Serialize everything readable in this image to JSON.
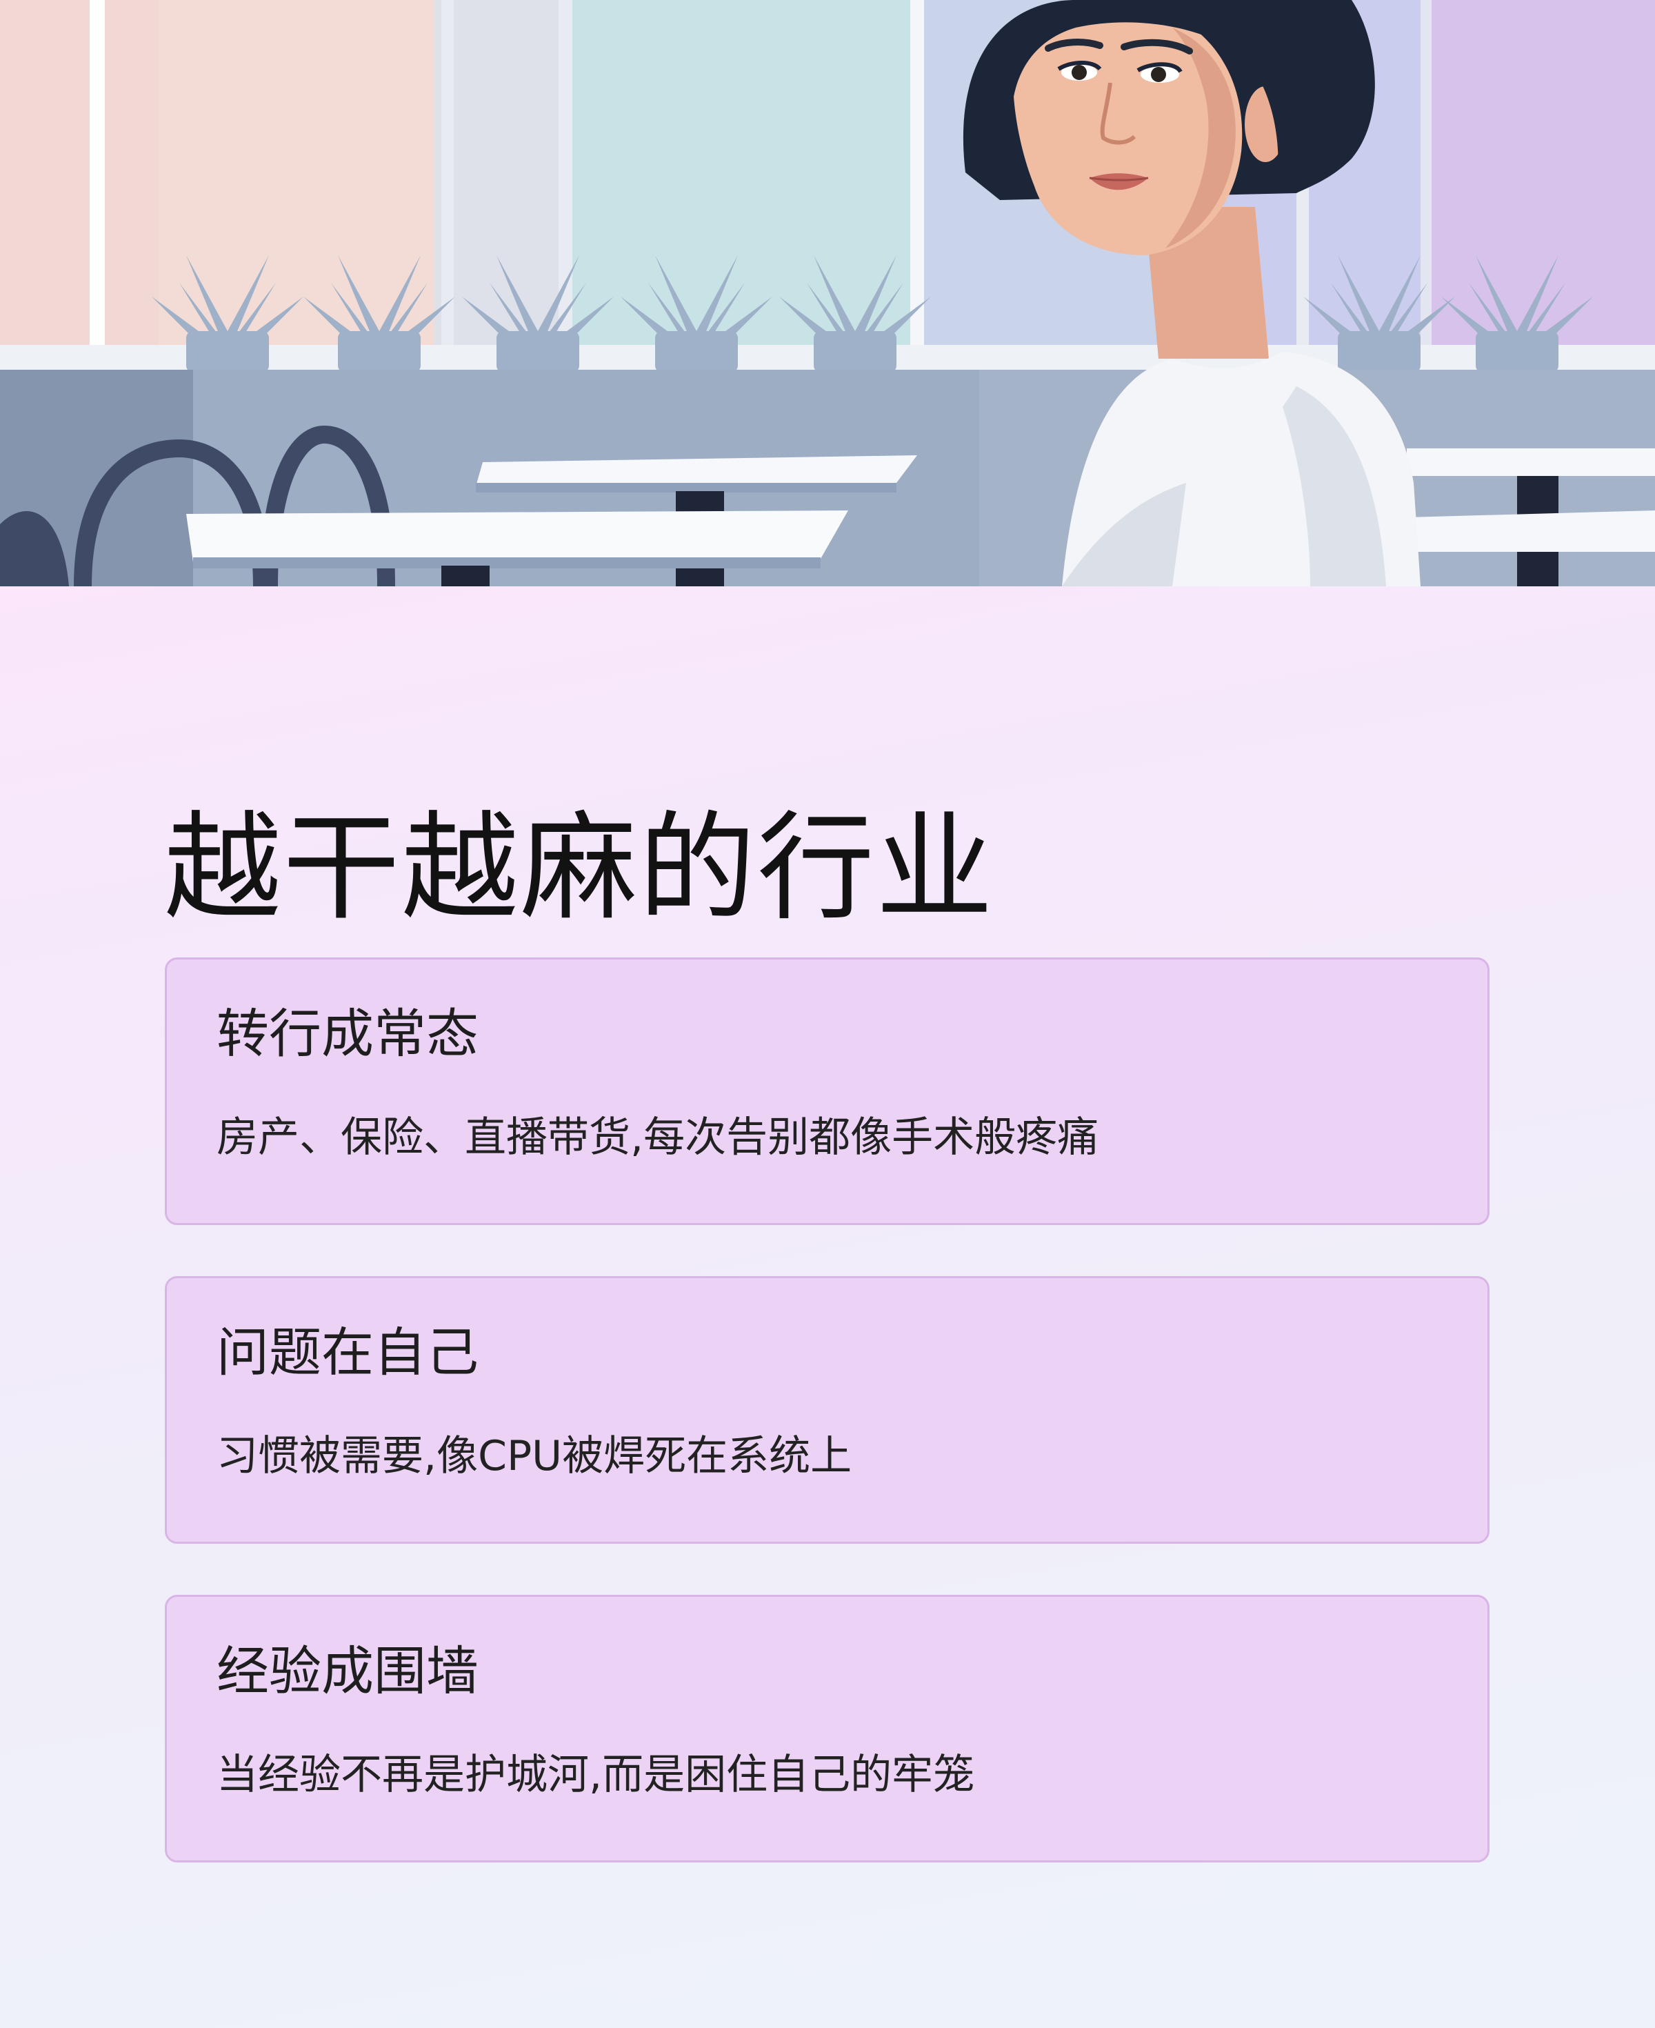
{
  "title": "越干越麻的行业",
  "cards": [
    {
      "title": "转行成常态",
      "desc": "房产、保险、直播带货,每次告别都像手术般疼痛"
    },
    {
      "title": "问题在自己",
      "desc": "习惯被需要,像CPU被焊死在系统上"
    },
    {
      "title": "经验成围墙",
      "desc": "当经验不再是护城河,而是困住自己的牢笼"
    }
  ],
  "colors": {
    "card_background": "#ecd3f5",
    "card_border": "#d8b5e4",
    "title_text": "#121212"
  }
}
